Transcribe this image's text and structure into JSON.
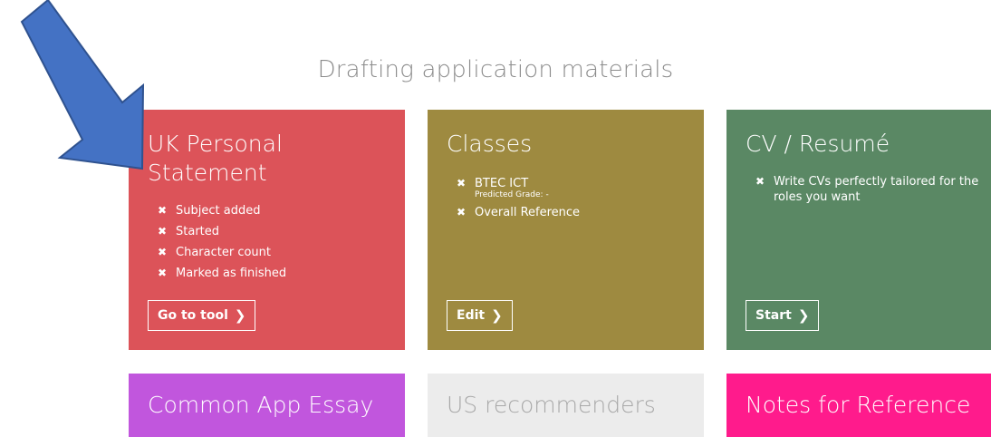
{
  "section": {
    "title": "Drafting application materials"
  },
  "colors": {
    "uk_card": "#dc5359",
    "classes_card": "#9e8a40",
    "cv_card": "#5a8864",
    "common_app_card": "#c156dd",
    "us_recommenders_card": "#ececec",
    "notes_card": "#ff1b8c",
    "arrow": "#4472c4"
  },
  "cards": {
    "uk": {
      "title": "UK Personal Statement",
      "items": [
        "Subject added",
        "Started",
        "Character count",
        "Marked as finished"
      ],
      "button": "Go to tool"
    },
    "classes": {
      "title": "Classes",
      "items": [
        {
          "label": "BTEC ICT",
          "sub": "Predicted Grade: -"
        },
        {
          "label": "Overall Reference"
        }
      ],
      "button": "Edit"
    },
    "cv": {
      "title": "CV / Resumé",
      "items": [
        "Write CVs perfectly tailored for the roles you want"
      ],
      "button": "Start"
    },
    "common_app": {
      "title": "Common App Essay"
    },
    "us_recommenders": {
      "title": "US recommenders"
    },
    "notes": {
      "title": "Notes for Reference"
    }
  }
}
